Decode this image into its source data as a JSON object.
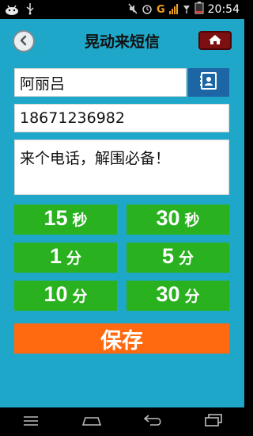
{
  "status_bar": {
    "time": "20:54",
    "network_letter": "G",
    "battery_level": "2"
  },
  "header": {
    "title": "晃动来短信"
  },
  "form": {
    "name_value": "阿丽吕",
    "phone_value": "18671236982",
    "message_value": "来个电话，解围必备！"
  },
  "time_options": [
    {
      "num": "15",
      "unit": "秒"
    },
    {
      "num": "30",
      "unit": "秒"
    },
    {
      "num": "1",
      "unit": "分"
    },
    {
      "num": "5",
      "unit": "分"
    },
    {
      "num": "10",
      "unit": "分"
    },
    {
      "num": "30",
      "unit": "分"
    }
  ],
  "save_label": "保存",
  "colors": {
    "background": "#1fa7c9",
    "time_button": "#2ab11f",
    "save_button": "#ff6a10",
    "home_button": "#7c0f10",
    "contact_button": "#1d66a6"
  },
  "icons": {
    "back": "back-arrow-icon",
    "home": "home-icon",
    "contact": "contact-card-icon",
    "nav_menu": "menu-icon",
    "nav_home": "home-nav-icon",
    "nav_back": "back-nav-icon",
    "nav_recent": "recent-apps-icon"
  }
}
